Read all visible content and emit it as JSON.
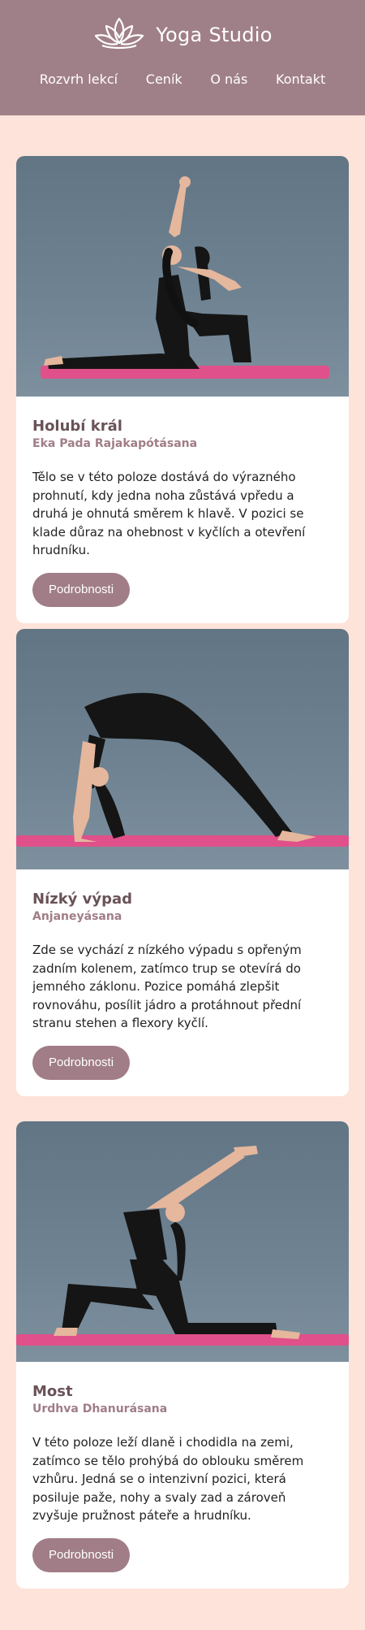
{
  "header": {
    "brand": "Yoga Studio",
    "nav": [
      "Rozvrh lekcí",
      "Ceník",
      "O nás",
      "Kontakt"
    ]
  },
  "cards": [
    {
      "title": "Holubí král",
      "subtitle": "Eka Pada Rajakapótásana",
      "text": "Tělo se v této poloze dostává do výrazného prohnutí, kdy jedna noha zůstává vpředu a druhá je ohnutá směrem k hlavě. V pozici se klade důraz na ohebnost v kyčlích a otevření hrudníku.",
      "button": "Podrobnosti"
    },
    {
      "title": "Nízký výpad",
      "subtitle": "Anjaneyásana",
      "text": "Zde se vychází z nízkého výpadu s opřeným zadním kolenem, zatímco trup se otevírá do jemného záklonu. Pozice pomáhá zlepšit rovnováhu, posílit jádro a protáhnout přední stranu stehen a flexory kyčlí.",
      "button": "Podrobnosti"
    },
    {
      "title": "Most",
      "subtitle": "Urdhva Dhanurásana",
      "text": "V této poloze leží dlaně i chodidla na zemi, zatímco se tělo prohýbá do oblouku směrem vzhůru. Jedná se o intenzivní pozici, která posiluje paže, nohy a svaly zad a zároveň zvyšuje pružnost páteře a hrudníku.",
      "button": "Podrobnosti"
    }
  ],
  "colors": {
    "header_bg": "#a08088",
    "page_bg": "#fde3d9",
    "accent": "#a07d87",
    "mat": "#e0508a"
  },
  "icons": {
    "logo": "lotus-icon"
  }
}
